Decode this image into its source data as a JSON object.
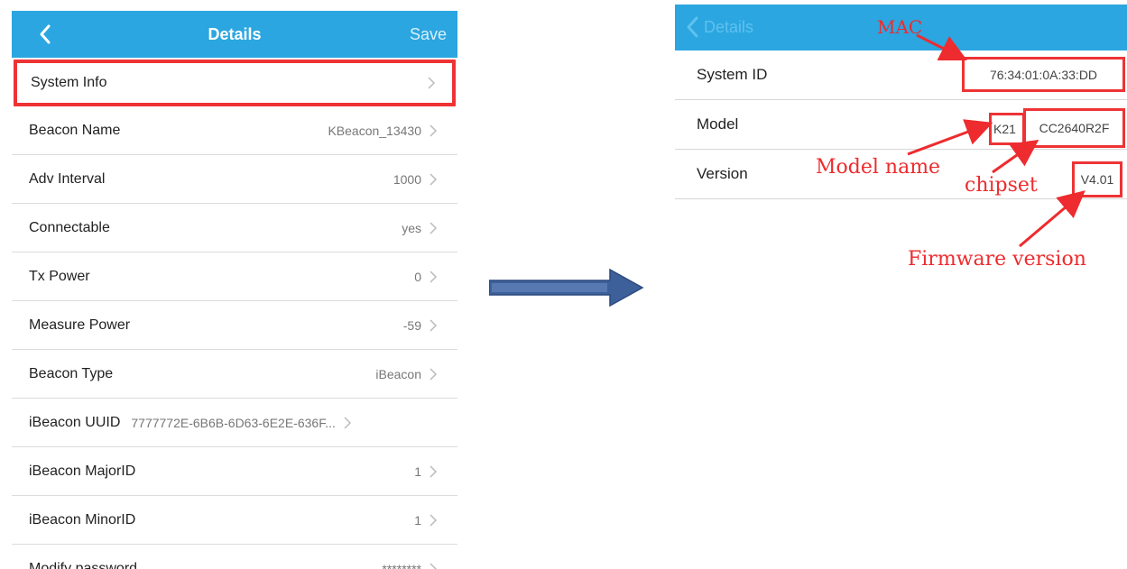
{
  "left_screen": {
    "header": {
      "title": "Details",
      "save_label": "Save",
      "back_icon": "chevron-left-icon"
    },
    "rows": [
      {
        "label": "System Info",
        "value": ""
      },
      {
        "label": "Beacon Name",
        "value": "KBeacon_13430"
      },
      {
        "label": "Adv Interval",
        "value": "1000"
      },
      {
        "label": "Connectable",
        "value": "yes"
      },
      {
        "label": "Tx Power",
        "value": "0"
      },
      {
        "label": "Measure Power",
        "value": "-59"
      },
      {
        "label": "Beacon Type",
        "value": "iBeacon"
      },
      {
        "label": "iBeacon UUID",
        "value": "7777772E-6B6B-6D63-6E2E-636F..."
      },
      {
        "label": "iBeacon MajorID",
        "value": "1"
      },
      {
        "label": "iBeacon MinorID",
        "value": "1"
      },
      {
        "label": "Modify password",
        "value": "********"
      }
    ],
    "highlight_color": "#ee3335",
    "header_color": "#2ba6e0"
  },
  "arrow": {
    "icon": "right-arrow-icon",
    "color": "#3d5f9a"
  },
  "right_screen": {
    "header": {
      "back_label": "Details",
      "back_icon": "chevron-left-icon"
    },
    "rows": [
      {
        "label": "System ID",
        "value": "76:34:01:0A:33:DD"
      },
      {
        "label": "Model",
        "model_name": "K21",
        "chipset": "CC2640R2F"
      },
      {
        "label": "Version",
        "value": "V4.01"
      }
    ],
    "annotations": {
      "mac": "MAC",
      "model_name": "Model name",
      "chipset": "chipset",
      "firmware": "Firmware version"
    },
    "annotation_color": "#ee2b2e"
  }
}
